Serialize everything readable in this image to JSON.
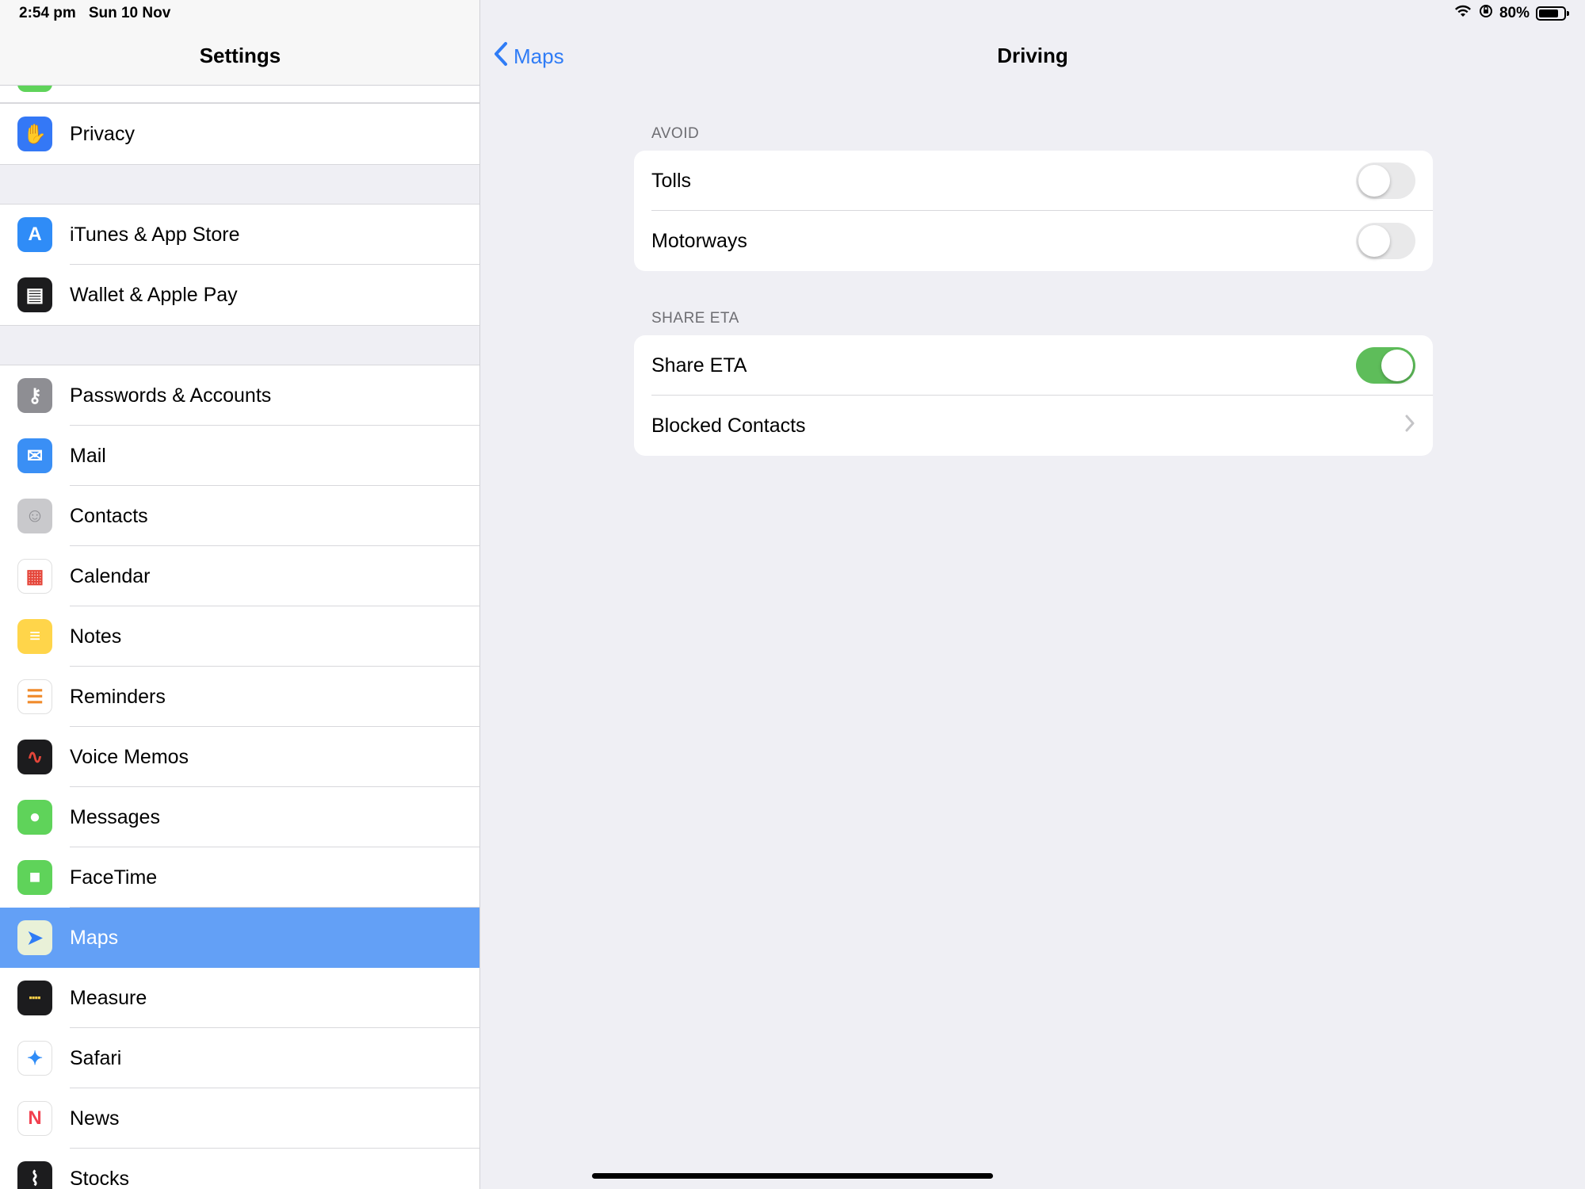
{
  "status_bar": {
    "time": "2:54 pm",
    "date": "Sun 10 Nov",
    "battery_text": "80%",
    "battery_level": 0.8
  },
  "sidebar": {
    "title": "Settings",
    "groups": [
      {
        "items": [
          {
            "label": "Privacy",
            "icon": "hand-icon",
            "color": "#3478f6"
          }
        ]
      },
      {
        "items": [
          {
            "label": "iTunes & App Store",
            "icon": "app-store-icon",
            "color": "#2f8cf7"
          },
          {
            "label": "Wallet & Apple Pay",
            "icon": "wallet-icon",
            "color": "#1c1c1e"
          }
        ]
      },
      {
        "items": [
          {
            "label": "Passwords & Accounts",
            "icon": "key-icon",
            "color": "#8e8e93"
          },
          {
            "label": "Mail",
            "icon": "mail-icon",
            "color": "#3a8ff5"
          },
          {
            "label": "Contacts",
            "icon": "contacts-icon",
            "color": "#c9c9cc"
          },
          {
            "label": "Calendar",
            "icon": "calendar-icon",
            "color": "#ffffff"
          },
          {
            "label": "Notes",
            "icon": "notes-icon",
            "color": "#ffd54a"
          },
          {
            "label": "Reminders",
            "icon": "reminders-icon",
            "color": "#ffffff"
          },
          {
            "label": "Voice Memos",
            "icon": "voice-memos-icon",
            "color": "#1c1c1e"
          },
          {
            "label": "Messages",
            "icon": "messages-icon",
            "color": "#5fd35a"
          },
          {
            "label": "FaceTime",
            "icon": "facetime-icon",
            "color": "#5fd35a"
          },
          {
            "label": "Maps",
            "icon": "maps-icon",
            "color": "#e9f1d8",
            "selected": true
          },
          {
            "label": "Measure",
            "icon": "measure-icon",
            "color": "#1c1c1e"
          },
          {
            "label": "Safari",
            "icon": "safari-icon",
            "color": "#ffffff"
          },
          {
            "label": "News",
            "icon": "news-icon",
            "color": "#ffffff"
          },
          {
            "label": "Stocks",
            "icon": "stocks-icon",
            "color": "#1c1c1e"
          }
        ]
      }
    ]
  },
  "detail": {
    "back_label": "Maps",
    "title": "Driving",
    "sections": [
      {
        "header": "AVOID",
        "rows": [
          {
            "label": "Tolls",
            "type": "toggle",
            "on": false
          },
          {
            "label": "Motorways",
            "type": "toggle",
            "on": false
          }
        ]
      },
      {
        "header": "SHARE ETA",
        "rows": [
          {
            "label": "Share ETA",
            "type": "toggle",
            "on": true
          },
          {
            "label": "Blocked Contacts",
            "type": "disclosure"
          }
        ]
      }
    ]
  },
  "colors": {
    "accent": "#2f7cf6",
    "selection": "#63a0f6",
    "toggle_on": "#5ebd5a"
  }
}
